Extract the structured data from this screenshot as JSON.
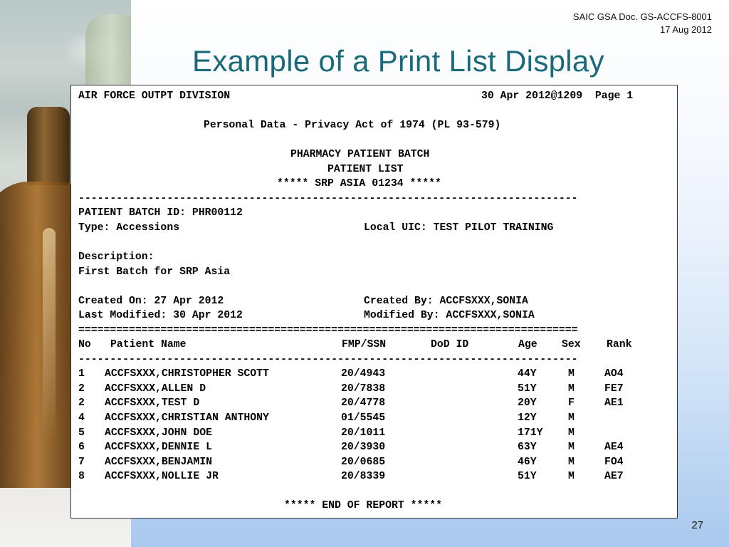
{
  "doc_meta": {
    "line1": "SAIC GSA Doc. GS-ACCFS-8001",
    "line2": "17 Aug 2012"
  },
  "title": "Example of a Print List Display",
  "page_number": "27",
  "report": {
    "division": "AIR FORCE OUTPT DIVISION",
    "date_page": "30 Apr 2012@1209  Page 1",
    "privacy": "Personal Data - Privacy Act of 1974 (PL 93-579)",
    "heading1": "PHARMACY PATIENT BATCH",
    "heading2": "PATIENT LIST",
    "heading3": "***** SRP ASIA 01234 *****",
    "dash_line": "-------------------------------------------------------------------------------",
    "batch_id": "PATIENT BATCH ID: PHR00112",
    "type": "Type: Accessions",
    "local_uic": "Local UIC: TEST PILOT TRAINING",
    "description_label": "Description:",
    "description": "First Batch for SRP Asia",
    "created_on": "Created On: 27 Apr 2012",
    "created_by": "Created By: ACCFSXXX,SONIA",
    "last_modified": "Last Modified: 30 Apr 2012",
    "modified_by": "Modified By: ACCFSXXX,SONIA",
    "equals_line": "===============================================================================",
    "columns": {
      "no": "No",
      "name": "Patient Name",
      "fmp_ssn": "FMP/SSN",
      "dod_id": "DoD ID",
      "age": "Age",
      "sex": "Sex",
      "rank": "Rank"
    },
    "patients": [
      {
        "no": "1",
        "name": "ACCFSXXX,CHRISTOPHER SCOTT",
        "fmp_ssn": "20/4943",
        "age": "44Y",
        "sex": "M",
        "rank": "AO4"
      },
      {
        "no": "2",
        "name": "ACCFSXXX,ALLEN D",
        "fmp_ssn": "20/7838",
        "age": "51Y",
        "sex": "M",
        "rank": "FE7"
      },
      {
        "no": "2",
        "name": "ACCFSXXX,TEST D",
        "fmp_ssn": "20/4778",
        "age": "20Y",
        "sex": "F",
        "rank": "AE1"
      },
      {
        "no": "4",
        "name": "ACCFSXXX,CHRISTIAN ANTHONY",
        "fmp_ssn": "01/5545",
        "age": "12Y",
        "sex": "M",
        "rank": ""
      },
      {
        "no": "5",
        "name": "ACCFSXXX,JOHN DOE",
        "fmp_ssn": "20/1011",
        "age": "171Y",
        "sex": "M",
        "rank": ""
      },
      {
        "no": "6",
        "name": "ACCFSXXX,DENNIE L",
        "fmp_ssn": "20/3930",
        "age": "63Y",
        "sex": "M",
        "rank": "AE4"
      },
      {
        "no": "7",
        "name": "ACCFSXXX,BENJAMIN",
        "fmp_ssn": "20/0685",
        "age": "46Y",
        "sex": "M",
        "rank": "FO4"
      },
      {
        "no": "8",
        "name": "ACCFSXXX,NOLLIE JR",
        "fmp_ssn": "20/8339",
        "age": "51Y",
        "sex": "M",
        "rank": "AE7"
      }
    ],
    "end_text": "***** END OF REPORT *****"
  }
}
